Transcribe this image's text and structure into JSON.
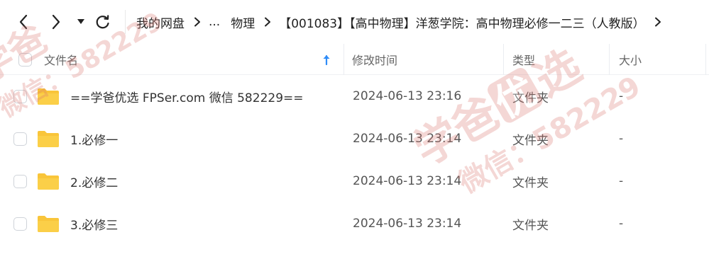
{
  "nav": {
    "back_icon": "chevron-left-icon",
    "forward_icon": "chevron-right-icon",
    "dropdown_icon": "caret-down-icon",
    "refresh_icon": "refresh-icon"
  },
  "breadcrumb": {
    "root": "我的网盘",
    "ellipsis": "...",
    "level1": "物理",
    "current": "【001083】【高中物理】洋葱学院：高中物理必修一二三（人教版）",
    "separator_icon": "chevron-right-icon"
  },
  "table": {
    "headers": {
      "name": "文件名",
      "modified": "修改时间",
      "type": "类型",
      "size": "大小"
    },
    "sort_icon": "arrow-up-icon",
    "sort_color": "#2f8cf7",
    "rows": [
      {
        "name": "==学爸优选 FPSer.com 微信 582229==",
        "modified": "2024-06-13 23:16",
        "type": "文件夹",
        "size": "-"
      },
      {
        "name": "1.必修一",
        "modified": "2024-06-13 23:14",
        "type": "文件夹",
        "size": "-"
      },
      {
        "name": "2.必修二",
        "modified": "2024-06-13 23:14",
        "type": "文件夹",
        "size": "-"
      },
      {
        "name": "3.必修三",
        "modified": "2024-06-13 23:14",
        "type": "文件夹",
        "size": "-"
      }
    ],
    "folder_color": "#f9c53a"
  },
  "watermark": {
    "brand": "学爸",
    "badge": "优",
    "tail": "选",
    "line2": "微信：582229",
    "color": "#e8a7a3"
  }
}
